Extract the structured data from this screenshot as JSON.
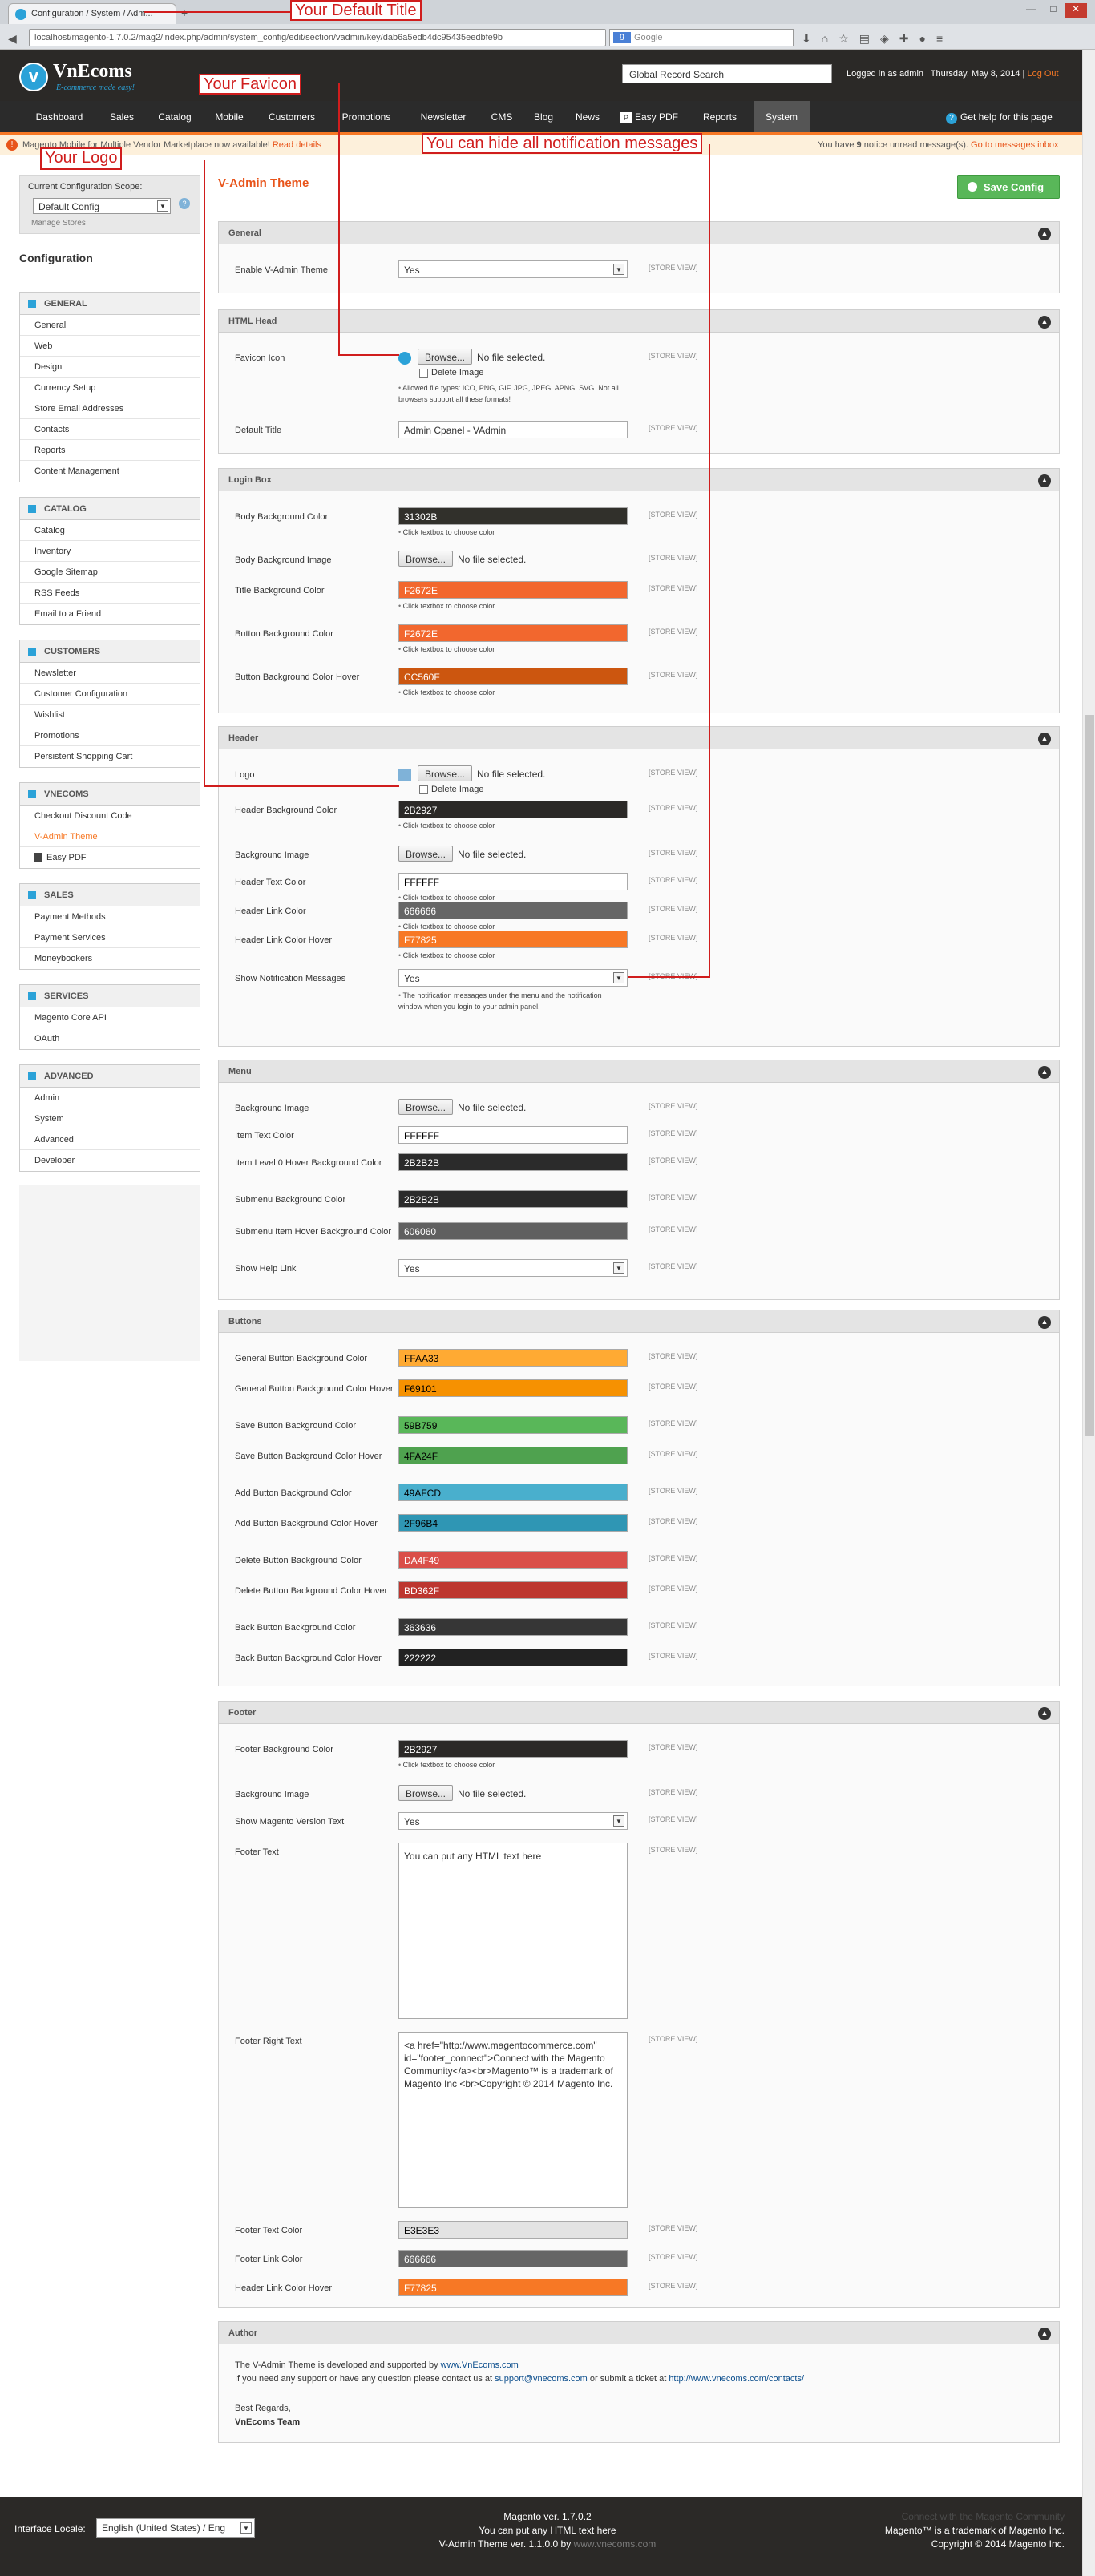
{
  "browser": {
    "tab_title": "Configuration / System / Adm...",
    "new_tab": "+",
    "url": "localhost/magento-1.7.0.2/mag2/index.php/admin/system_config/edit/section/vadmin/key/dab6a5edb4dc95435eedbfe9b",
    "search_placeholder": "Google",
    "search_engine": "g"
  },
  "header": {
    "logo_name": "VnEcoms",
    "logo_tagline": "E-commerce made easy!",
    "global_search_placeholder": "Global Record Search",
    "logged_in": "Logged in as admin",
    "date": "Thursday, May 8, 2014",
    "logout": "Log Out"
  },
  "menu": {
    "items": [
      "Dashboard",
      "Sales",
      "Catalog",
      "Mobile",
      "Customers",
      "Promotions",
      "Newsletter",
      "CMS",
      "Blog",
      "News",
      "Easy PDF",
      "Reports",
      "System"
    ],
    "help": "Get help for this page"
  },
  "notice": {
    "text": "Magento Mobile for Multiple Vendor Marketplace now available!",
    "read_details": "Read details",
    "right_prefix": "You have",
    "count": "9",
    "right_text": "notice unread message(s).",
    "inbox": "Go to messages inbox"
  },
  "annotations": {
    "default_title": "Your Default Title",
    "favicon": "Your Favicon",
    "logo": "Your Logo",
    "notifications": "You can hide all notification messages"
  },
  "sidebar": {
    "scope_label": "Current Configuration Scope:",
    "scope_value": "Default Config",
    "manage_stores": "Manage Stores",
    "title": "Configuration",
    "groups": [
      {
        "title": "GENERAL",
        "items": [
          "General",
          "Web",
          "Design",
          "Currency Setup",
          "Store Email Addresses",
          "Contacts",
          "Reports",
          "Content Management"
        ]
      },
      {
        "title": "CATALOG",
        "items": [
          "Catalog",
          "Inventory",
          "Google Sitemap",
          "RSS Feeds",
          "Email to a Friend"
        ]
      },
      {
        "title": "CUSTOMERS",
        "items": [
          "Newsletter",
          "Customer Configuration",
          "Wishlist",
          "Promotions",
          "Persistent Shopping Cart"
        ]
      },
      {
        "title": "VNECOMS",
        "items": [
          "Checkout Discount Code",
          "V-Admin Theme",
          "Easy PDF"
        ]
      },
      {
        "title": "SALES",
        "items": [
          "Payment Methods",
          "Payment Services",
          "Moneybookers"
        ]
      },
      {
        "title": "SERVICES",
        "items": [
          "Magento Core API",
          "OAuth"
        ]
      },
      {
        "title": "ADVANCED",
        "items": [
          "Admin",
          "System",
          "Advanced",
          "Developer"
        ]
      }
    ]
  },
  "main": {
    "page_title": "V-Admin Theme",
    "save_label": "Save Config",
    "store_view": "[STORE VIEW]",
    "click_note": "Click textbox to choose color",
    "browse": "Browse...",
    "no_file": "No file selected.",
    "delete_image": "Delete Image",
    "sections": {
      "general": {
        "title": "General",
        "enable_label": "Enable V-Admin Theme",
        "enable_value": "Yes"
      },
      "html_head": {
        "title": "HTML Head",
        "favicon_label": "Favicon Icon",
        "favicon_note": "Allowed file types: ICO, PNG, GIF, JPG, JPEG, APNG, SVG. Not all browsers support all these formats!",
        "title_label": "Default Title",
        "title_value": "Admin Cpanel - VAdmin"
      },
      "login_box": {
        "title": "Login Box",
        "rows": [
          {
            "label": "Body Background Color",
            "value": "31302B",
            "bg": "#31302B",
            "fg": "#ffffff"
          },
          {
            "label": "Body Background Image"
          },
          {
            "label": "Title Background Color",
            "value": "F2672E",
            "bg": "#F2672E",
            "fg": "#ffffff"
          },
          {
            "label": "Button Background Color",
            "value": "F2672E",
            "bg": "#F2672E",
            "fg": "#ffffff"
          },
          {
            "label": "Button Background Color Hover",
            "value": "CC560F",
            "bg": "#CC560F",
            "fg": "#ffffff"
          }
        ]
      },
      "header": {
        "title": "Header",
        "logo_label": "Logo",
        "rows": [
          {
            "label": "Header Background Color",
            "value": "2B2927",
            "bg": "#2B2927",
            "fg": "#ffffff"
          },
          {
            "label": "Background Image"
          },
          {
            "label": "Header Text Color",
            "value": "FFFFFF",
            "bg": "#FFFFFF",
            "fg": "#000000"
          },
          {
            "label": "Header Link Color",
            "value": "666666",
            "bg": "#666666",
            "fg": "#ffffff"
          },
          {
            "label": "Header Link Color Hover",
            "value": "F77825",
            "bg": "#F77825",
            "fg": "#ffffff"
          }
        ],
        "notify_label": "Show Notification Messages",
        "notify_value": "Yes",
        "notify_note": "The notification messages under the menu and the notification window when you login to your admin panel."
      },
      "menu": {
        "title": "Menu",
        "bg_label": "Background Image",
        "rows": [
          {
            "label": "Item Text Color",
            "value": "FFFFFF",
            "bg": "#FFFFFF",
            "fg": "#000000"
          },
          {
            "label": "Item Level 0 Hover Background Color",
            "value": "2B2B2B",
            "bg": "#2B2B2B",
            "fg": "#ffffff"
          },
          {
            "label": "Submenu Background Color",
            "value": "2B2B2B",
            "bg": "#2B2B2B",
            "fg": "#ffffff"
          },
          {
            "label": "Submenu Item Hover Background Color",
            "value": "606060",
            "bg": "#606060",
            "fg": "#ffffff"
          }
        ],
        "help_label": "Show Help Link",
        "help_value": "Yes"
      },
      "buttons": {
        "title": "Buttons",
        "rows": [
          {
            "label": "General Button Background Color",
            "value": "FFAA33",
            "bg": "#FFAA33",
            "fg": "#000000"
          },
          {
            "label": "General Button Background Color Hover",
            "value": "F69101",
            "bg": "#F69101",
            "fg": "#000000"
          },
          {
            "label": "Save Button Background Color",
            "value": "59B759",
            "bg": "#59B759",
            "fg": "#000000"
          },
          {
            "label": "Save Button Background Color Hover",
            "value": "4FA24F",
            "bg": "#4FA24F",
            "fg": "#000000"
          },
          {
            "label": "Add Button Background Color",
            "value": "49AFCD",
            "bg": "#49AFCD",
            "fg": "#000000"
          },
          {
            "label": "Add Button Background Color Hover",
            "value": "2F96B4",
            "bg": "#2F96B4",
            "fg": "#000000"
          },
          {
            "label": "Delete Button Background Color",
            "value": "DA4F49",
            "bg": "#DA4F49",
            "fg": "#ffffff"
          },
          {
            "label": "Delete Button Background Color Hover",
            "value": "BD362F",
            "bg": "#BD362F",
            "fg": "#ffffff"
          },
          {
            "label": "Back Button Background Color",
            "value": "363636",
            "bg": "#363636",
            "fg": "#ffffff"
          },
          {
            "label": "Back Button Background Color Hover",
            "value": "222222",
            "bg": "#222222",
            "fg": "#ffffff"
          }
        ]
      },
      "footer": {
        "title": "Footer",
        "bg_color_label": "Footer Background Color",
        "bg_color_value": "2B2927",
        "bg_image_label": "Background Image",
        "version_label": "Show Magento Version Text",
        "version_value": "Yes",
        "text_label": "Footer Text",
        "text_value": "You can put any HTML text here",
        "right_label": "Footer Right Text",
        "right_value": "<a href=\"http://www.magentocommerce.com\" id=\"footer_connect\">Connect with the Magento Community</a><br>Magento™ is a trademark of Magento Inc <br>Copyright © 2014 Magento Inc.",
        "rows": [
          {
            "label": "Footer Text Color",
            "value": "E3E3E3",
            "bg": "#E3E3E3",
            "fg": "#000000"
          },
          {
            "label": "Footer Link Color",
            "value": "666666",
            "bg": "#666666",
            "fg": "#ffffff"
          },
          {
            "label": "Header Link Color Hover",
            "value": "F77825",
            "bg": "#F77825",
            "fg": "#ffffff"
          }
        ]
      },
      "author": {
        "title": "Author",
        "line1_pre": "The V-Admin Theme is developed and supported by ",
        "line1_link": "www.VnEcoms.com",
        "line2_pre": "If you need any support or have any question please contact us at ",
        "line2_email": "support@vnecoms.com",
        "line2_mid": " or submit a ticket at ",
        "line2_link": "http://www.vnecoms.com/contacts/",
        "regards": "Best Regards,",
        "team": "VnEcoms Team"
      }
    }
  },
  "footer": {
    "locale_label": "Interface Locale:",
    "locale_value": "English (United States) / Eng",
    "version": "Magento ver. 1.7.0.2",
    "html_note": "You can put any HTML text here",
    "theme_version": "V-Admin Theme ver. 1.1.0.0 by",
    "theme_link": "www.vnecoms.com",
    "connect": "Connect with the Magento Community",
    "trademark": "Magento™ is a trademark of Magento Inc.",
    "copyright": "Copyright © 2014 Magento Inc."
  },
  "colors": {
    "accent": "#F77825",
    "header_bg": "#2B2927",
    "save_green": "#59B759",
    "annotation_red": "#D01D1D"
  }
}
